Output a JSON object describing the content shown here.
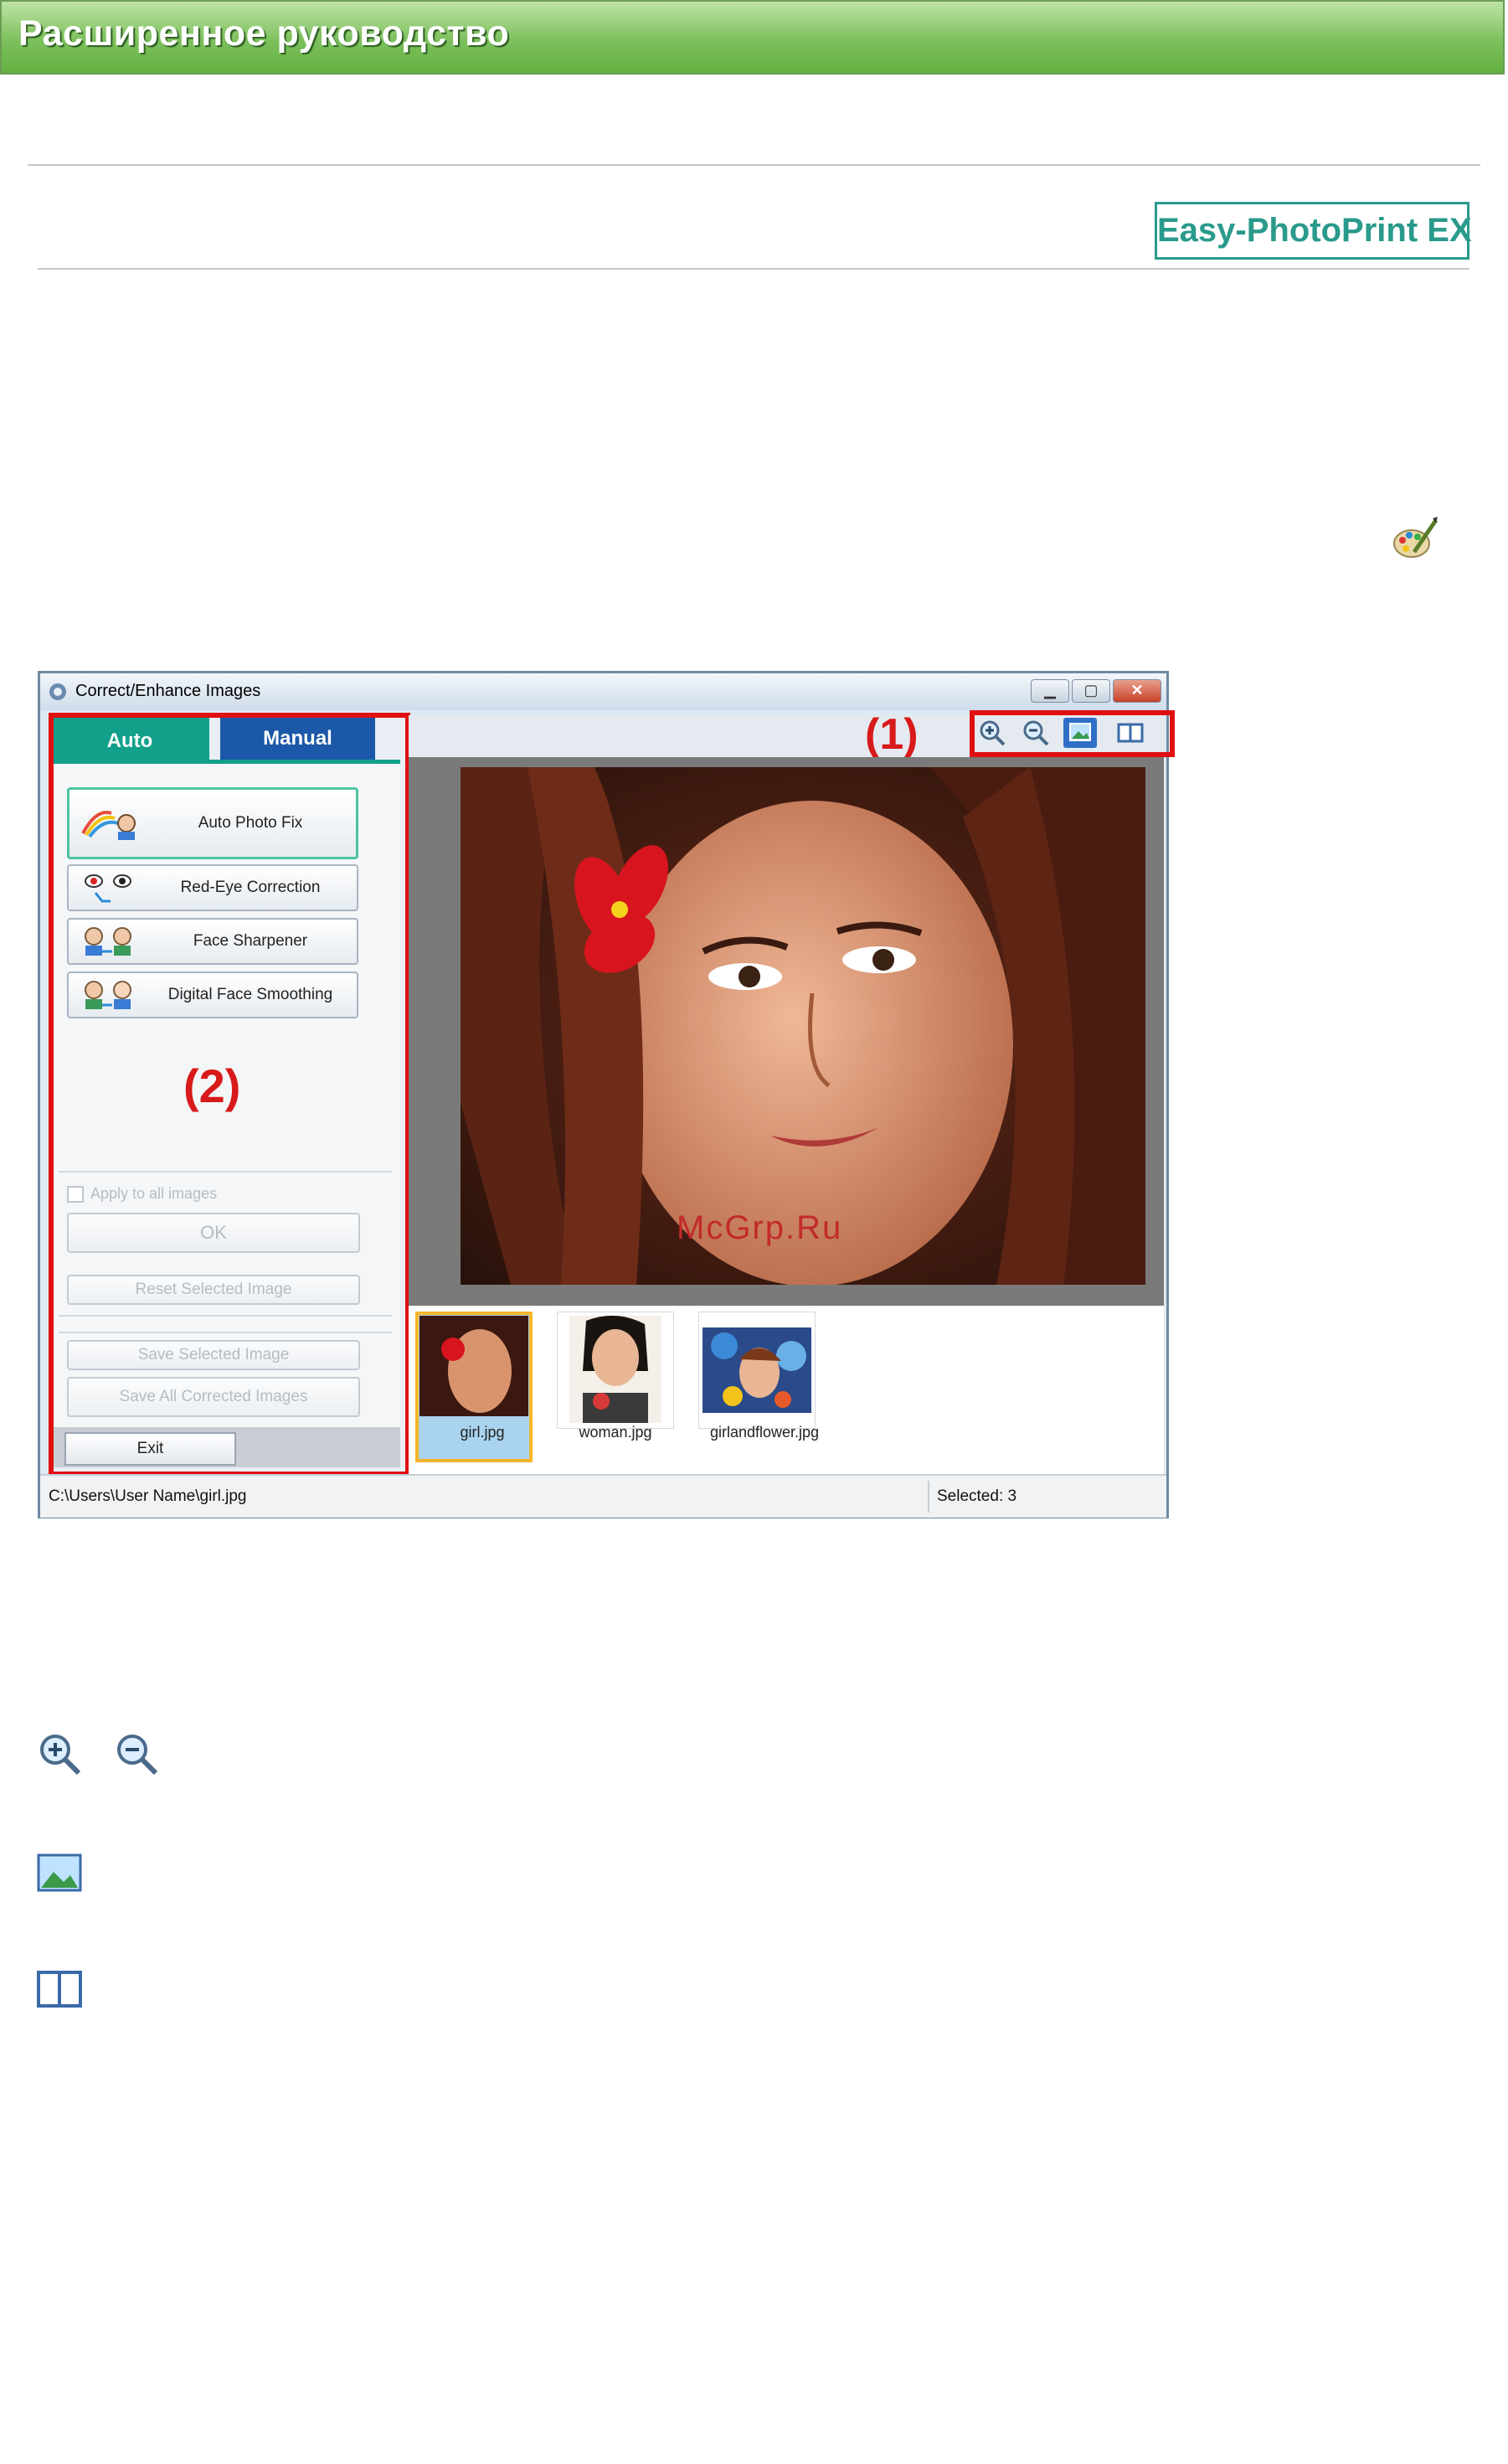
{
  "header": {
    "title": "Расширенное руководство"
  },
  "product_badge": "Easy-PhotoPrint EX",
  "icons": {
    "palette": "palette-brush-icon",
    "zoom_in": "zoom-in-icon",
    "zoom_out": "zoom-out-icon",
    "whole_image": "whole-image-icon",
    "compare": "compare-icon"
  },
  "window": {
    "title": "Correct/Enhance Images",
    "tabs": {
      "auto": "Auto",
      "manual": "Manual"
    },
    "tools": {
      "auto_photo_fix": "Auto Photo Fix",
      "red_eye": "Red-Eye Correction",
      "face_sharpener": "Face Sharpener",
      "face_smoothing": "Digital Face Smoothing"
    },
    "apply_all": "Apply to all images",
    "ok": "OK",
    "reset": "Reset Selected Image",
    "save_selected": "Save Selected Image",
    "save_all": "Save All Corrected Images",
    "exit": "Exit",
    "thumbnails": [
      "girl.jpg",
      "woman.jpg",
      "girlandflower.jpg"
    ],
    "status_path": "C:\\Users\\User Name\\girl.jpg",
    "status_selected": "Selected: 3",
    "watermark": "McGrp.Ru"
  },
  "callouts": {
    "one": "(1)",
    "two": "(2)"
  },
  "colors": {
    "banner": "#7cc05c",
    "auto_tab": "#12a08b",
    "manual_tab": "#1b58a8",
    "callout": "#e01010"
  }
}
